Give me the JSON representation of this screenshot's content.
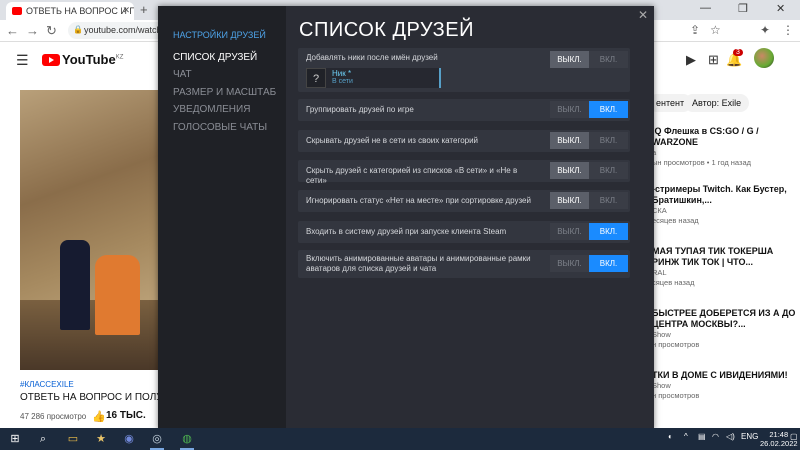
{
  "browser": {
    "tab_title": "ОТВЕТЬ НА ВОПРОС И ПО...",
    "url": "youtube.com/watch?"
  },
  "youtube": {
    "logo": "YouTube",
    "logo_region": "KZ",
    "notification_count": "3",
    "video_tag": "#КЛАССEXILE",
    "video_title": "ОТВЕТЬ НА ВОПРОС И ПОЛУ",
    "video_views": "47 286 просмотро",
    "video_likes": "16 ТЫС.",
    "chips": [
      "ентент",
      "Автор: Exile"
    ],
    "recommendations": [
      {
        "title": "IQ Флешка в CS:GO / G / WARZONE",
        "channel": "а",
        "meta": "ын просмотров • 1 год назад"
      },
      {
        "title": "-стримеры Twitch. Как Бустер, Братишкин,...",
        "channel": "СКА",
        "meta": "есяцев назад"
      },
      {
        "title": "МАЯ ТУПАЯ ТИК ТОКЕРША РИНЖ ТИК ТОК | ЧТО...",
        "channel": "RAL",
        "meta": "сяцев назад"
      },
      {
        "title": "БЫСТРЕЕ ДОБЕРЕТСЯ ИЗ А ДО ЦЕНТРА МОСКВЫ?...",
        "channel": "Show",
        "meta": "н просмотров"
      },
      {
        "title": "ТКИ В ДОМЕ С ИВИДЕНИЯМИ!",
        "channel": "Show",
        "meta": "н просмотров"
      }
    ]
  },
  "steam": {
    "sidebar": {
      "section": "НАСТРОЙКИ ДРУЗЕЙ",
      "items": [
        "СПИСОК ДРУЗЕЙ",
        "ЧАТ",
        "РАЗМЕР И МАСШТАБ",
        "УВЕДОМЛЕНИЯ",
        "ГОЛОСОВЫЕ ЧАТЫ"
      ]
    },
    "title": "СПИСОК ДРУЗЕЙ",
    "off_label": "ВЫКЛ.",
    "on_label": "ВКЛ.",
    "preview": {
      "avatar": "?",
      "nick": "Ник *",
      "status": "В сети"
    },
    "settings": [
      {
        "label": "Добавлять ники после имён друзей",
        "value": "off"
      },
      {
        "label": "Группировать друзей по игре",
        "value": "on"
      },
      {
        "label": "Скрывать друзей не в сети из своих категорий",
        "value": "off"
      },
      {
        "label": "Скрыть друзей с категорией из списков «В сети» и «Не в сети»",
        "value": "off"
      },
      {
        "label": "Игнорировать статус «Нет на месте» при сортировке друзей",
        "value": "off"
      },
      {
        "label": "Входить в систему друзей при запуске клиента Steam",
        "value": "on"
      },
      {
        "label": "Включить анимированные аватары и анимированные рамки аватаров для списка друзей и чата",
        "value": "on"
      }
    ]
  },
  "taskbar": {
    "lang": "ENG",
    "time": "21:48",
    "date": "26.02.2022"
  }
}
